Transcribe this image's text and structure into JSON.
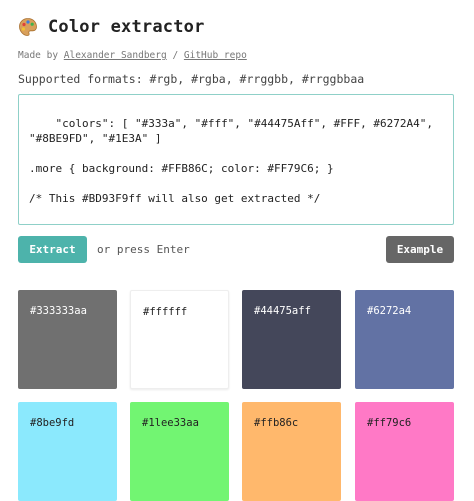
{
  "header": {
    "title": "Color extractor",
    "icon": "palette-icon"
  },
  "byline": {
    "prefix": "Made by ",
    "author": "Alexander Sandberg",
    "separator": " / ",
    "repo": "GitHub repo"
  },
  "formats": "Supported formats: #rgb, #rgba, #rrggbb, #rrggbbaa",
  "input": {
    "value": "\"colors\": [ \"#333a\", \"#fff\", \"#44475Aff\", #FFF, #6272A4\",\n\"#8BE9FD\", \"#1E3A\" ]\n\n.more { background: #FFB86C; color: #FF79C6; }\n\n/* This #BD93F9ff will also get extracted */"
  },
  "actions": {
    "extract_label": "Extract",
    "hint": "or press Enter",
    "example_label": "Example"
  },
  "swatches": [
    {
      "code": "#333333aa",
      "bg": "#707070",
      "fg": "#ffffff"
    },
    {
      "code": "#ffffff",
      "bg": "#ffffff",
      "fg": "#222222"
    },
    {
      "code": "#44475aff",
      "bg": "#44475a",
      "fg": "#ffffff"
    },
    {
      "code": "#6272a4",
      "bg": "#6272a4",
      "fg": "#ffffff"
    },
    {
      "code": "#8be9fd",
      "bg": "#8be9fd",
      "fg": "#222222"
    },
    {
      "code": "#1lee33aa",
      "bg": "#72f572",
      "fg": "#222222"
    },
    {
      "code": "#ffb86c",
      "bg": "#ffb86c",
      "fg": "#222222"
    },
    {
      "code": "#ff79c6",
      "bg": "#ff79c6",
      "fg": "#222222"
    }
  ],
  "colors": {
    "accent": "#4db3ab",
    "secondary_button": "#666666",
    "input_border": "#8fd0c8"
  }
}
